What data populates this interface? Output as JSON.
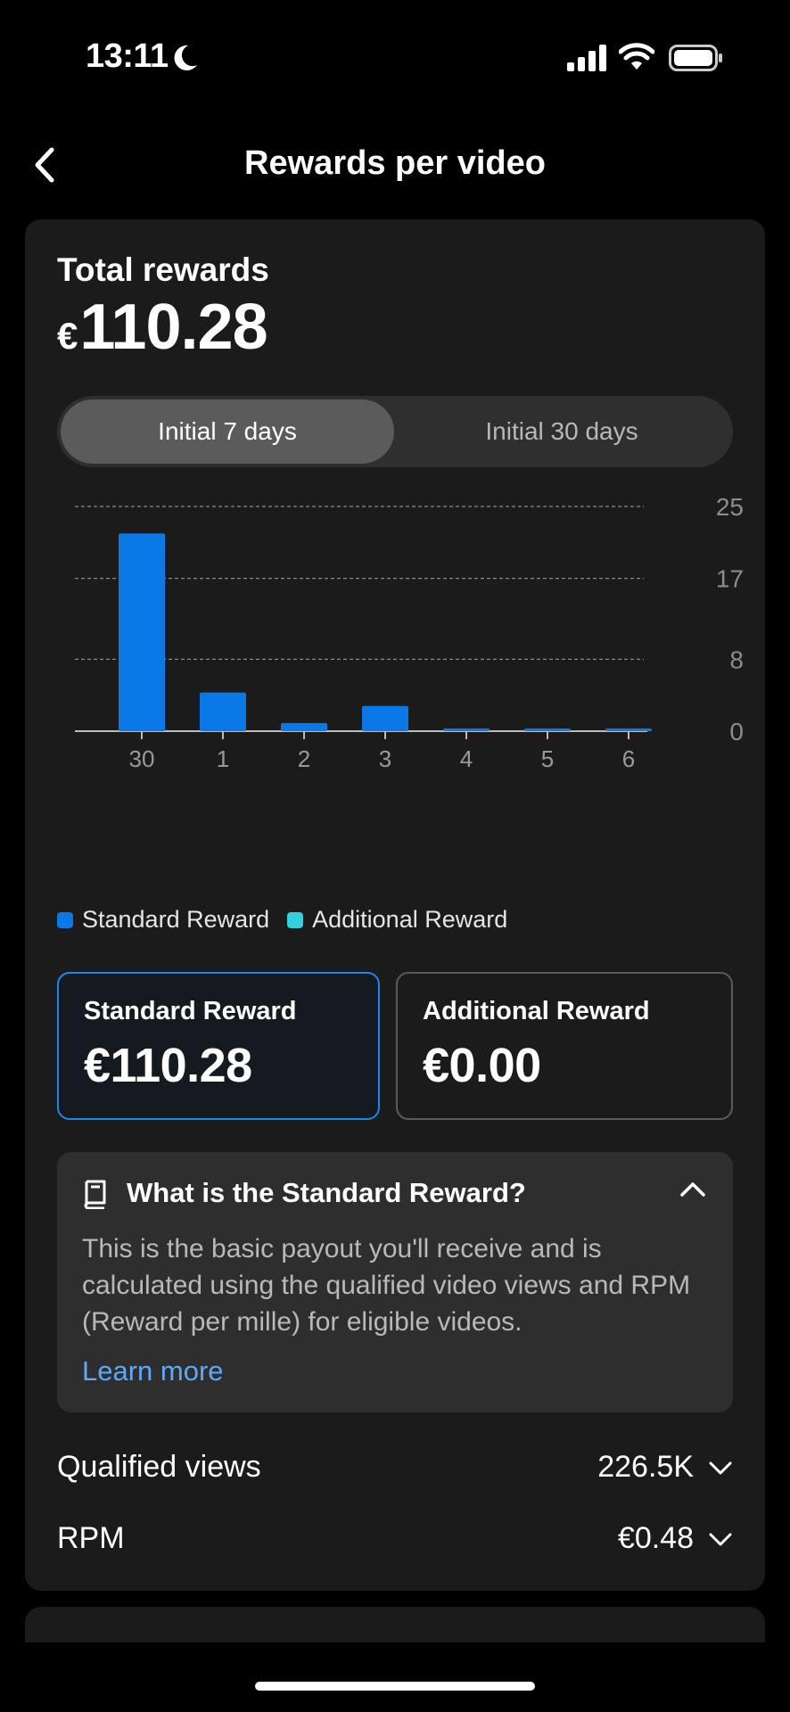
{
  "status_bar": {
    "time": "13:11"
  },
  "header": {
    "title": "Rewards per video"
  },
  "summary": {
    "label": "Total rewards",
    "currency": "€",
    "amount": "110.28"
  },
  "tabs": [
    {
      "label": "Initial 7 days",
      "selected": true
    },
    {
      "label": "Initial 30 days",
      "selected": false
    }
  ],
  "chart_data": {
    "type": "bar",
    "categories": [
      "30",
      "1",
      "2",
      "3",
      "4",
      "5",
      "6"
    ],
    "series": [
      {
        "name": "Standard Reward",
        "color": "#0a78e6",
        "values": [
          22.0,
          4.3,
          0.9,
          2.8,
          0.1,
          0.1,
          0.1
        ]
      },
      {
        "name": "Additional Reward",
        "color": "#35d0e0",
        "values": [
          0,
          0,
          0,
          0,
          0,
          0,
          0
        ]
      }
    ],
    "y_ticks": [
      "25",
      "17",
      "8",
      "0"
    ],
    "ylim": [
      0,
      25
    ],
    "y_axis_side": "right",
    "grid": true
  },
  "legend": [
    {
      "label": "Standard Reward",
      "color": "#0a78e6"
    },
    {
      "label": "Additional Reward",
      "color": "#35d0e0"
    }
  ],
  "reward_boxes": {
    "standard": {
      "label": "Standard Reward",
      "value": "€110.28"
    },
    "additional": {
      "label": "Additional Reward",
      "value": "€0.00"
    }
  },
  "info": {
    "title": "What is the Standard Reward?",
    "body": "This is the basic payout you'll receive and is calculated using the qualified video views and RPM (Reward per mille) for eligible videos.",
    "link": "Learn more"
  },
  "metrics": [
    {
      "label": "Qualified views",
      "value": "226.5K"
    },
    {
      "label": "RPM",
      "value": "€0.48"
    }
  ],
  "icons": [
    "moon-icon",
    "cellular-signal-icon",
    "wifi-icon",
    "battery-icon",
    "back-chevron-icon",
    "book-icon",
    "chevron-up-icon",
    "chevron-down-icon"
  ]
}
